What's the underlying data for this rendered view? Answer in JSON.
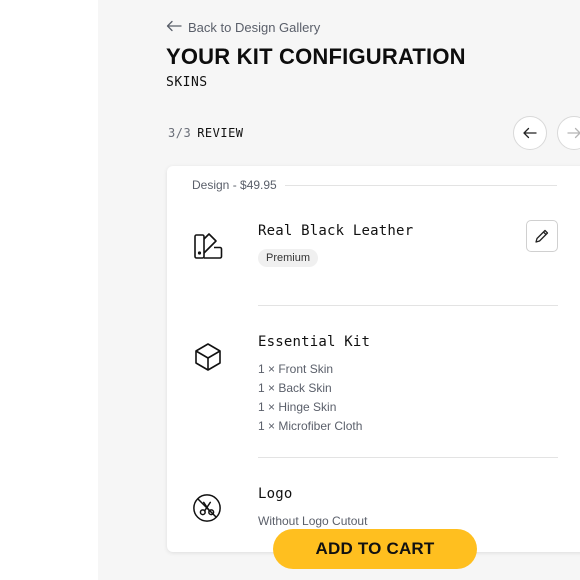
{
  "header": {
    "back_label": "Back to Design Gallery",
    "title": "YOUR KIT CONFIGURATION",
    "subtitle": "SKINS"
  },
  "stepper": {
    "step": "3/3",
    "label": "REVIEW"
  },
  "summary": {
    "design_label": "Design - $49.95",
    "items": [
      {
        "title": "Real Black Leather",
        "badge": "Premium",
        "icon": "swatch-icon"
      },
      {
        "title": "Essential Kit",
        "icon": "cube-icon",
        "parts": [
          "1 × Front Skin",
          "1 × Back Skin",
          "1 × Hinge Skin",
          "1 × Microfiber Cloth"
        ]
      },
      {
        "title": "Logo",
        "icon": "no-cut-icon",
        "detail": "Without Logo Cutout"
      }
    ]
  },
  "cart": {
    "label": "ADD TO CART"
  },
  "colors": {
    "accent": "#ffbf1f",
    "background": "#f6f6f6"
  }
}
